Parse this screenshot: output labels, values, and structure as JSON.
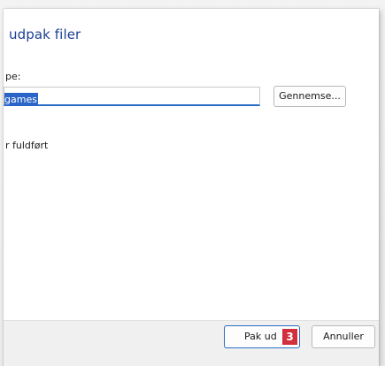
{
  "dialog": {
    "title": "udpak filer",
    "path_label": "pe:",
    "path_value": "games",
    "browse_label": "Gennemse...",
    "checkbox_label": "r fuldført"
  },
  "footer": {
    "extract_label": "Pak ud",
    "step_badge": "3",
    "cancel_label": "Annuller"
  },
  "colors": {
    "title": "#1c3f94",
    "selection": "#2a64c8",
    "focus_border": "#2b6cc4",
    "badge": "#d12f3c"
  }
}
